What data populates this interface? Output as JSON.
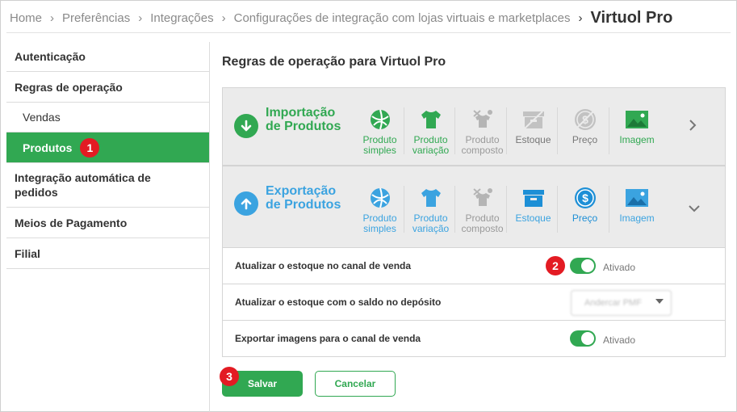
{
  "breadcrumb": {
    "items": [
      "Home",
      "Preferências",
      "Integrações",
      "Configurações de integração com lojas virtuais e marketplaces"
    ],
    "current": "Virtuol Pro"
  },
  "sidebar": {
    "items": [
      {
        "label": "Autenticação"
      },
      {
        "label": "Regras de operação"
      },
      {
        "label": "Vendas"
      },
      {
        "label": "Produtos",
        "badge": "1"
      },
      {
        "label": "Integração automática de pedidos"
      },
      {
        "label": "Meios de Pagamento"
      },
      {
        "label": "Filial"
      }
    ]
  },
  "main": {
    "title": "Regras de operação para Virtuol Pro",
    "importacao": {
      "title": "Importação de Produtos",
      "tiles": [
        {
          "label": "Produto simples",
          "icon": "ball-icon"
        },
        {
          "label": "Produto variação",
          "icon": "shirt-icon"
        },
        {
          "label": "Produto composto",
          "icon": "composite-icon"
        },
        {
          "label": "Estoque",
          "icon": "box-icon"
        },
        {
          "label": "Preço",
          "icon": "dollar-icon"
        },
        {
          "label": "Imagem",
          "icon": "image-icon"
        }
      ]
    },
    "exportacao": {
      "title": "Exportação de Produtos",
      "tiles": [
        {
          "label": "Produto simples",
          "icon": "ball-icon"
        },
        {
          "label": "Produto variação",
          "icon": "shirt-icon"
        },
        {
          "label": "Produto composto",
          "icon": "composite-icon"
        },
        {
          "label": "Estoque",
          "icon": "box-icon"
        },
        {
          "label": "Preço",
          "icon": "dollar-icon"
        },
        {
          "label": "Imagem",
          "icon": "image-icon"
        }
      ]
    },
    "settings": [
      {
        "label": "Atualizar o estoque no canal de venda",
        "status": "Ativado",
        "badge": "2"
      },
      {
        "label": "Atualizar o estoque com o saldo no depósito",
        "select_value": "Andercar PMF"
      },
      {
        "label": "Exportar imagens para o canal de venda",
        "status": "Ativado"
      }
    ]
  },
  "buttons": {
    "save": "Salvar",
    "cancel": "Cancelar",
    "save_badge": "3"
  },
  "colors": {
    "green": "#31a852",
    "blue": "#3ba3e0",
    "gray_icon": "#b5b5b5",
    "badge_red": "#e31b23"
  }
}
